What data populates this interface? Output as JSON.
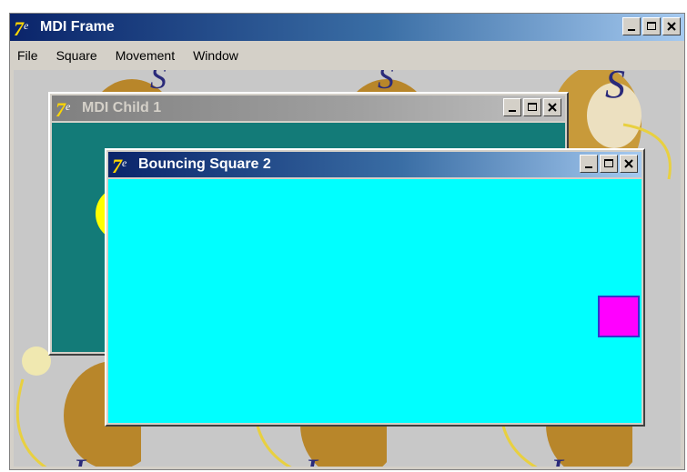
{
  "frame": {
    "title": "MDI Frame",
    "menu": [
      "File",
      "Square",
      "Movement",
      "Window"
    ]
  },
  "child1": {
    "title": "MDI Child 1",
    "background": "#137b78"
  },
  "child2": {
    "title": "Bouncing Square 2",
    "background": "#00ffff",
    "square_color": "#ff00ff",
    "square_border": "#3333cc"
  },
  "icons": {
    "app": "app-logo-icon",
    "minimize": "minimize-icon",
    "maximize": "maximize-icon",
    "close": "close-icon"
  }
}
